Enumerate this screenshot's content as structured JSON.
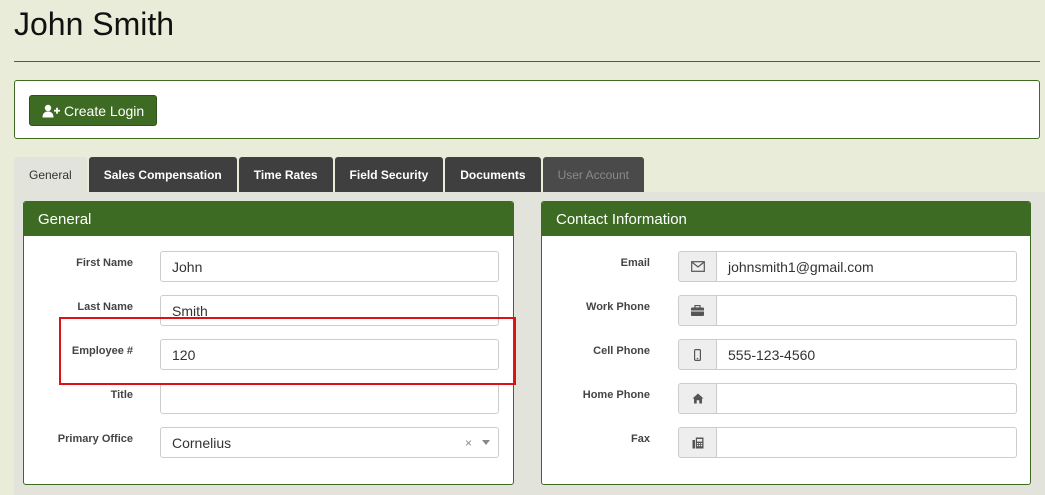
{
  "page": {
    "title": "John Smith"
  },
  "actions": {
    "create_login_label": "Create Login"
  },
  "tabs": [
    {
      "label": "General",
      "state": "active"
    },
    {
      "label": "Sales Compensation",
      "state": "normal"
    },
    {
      "label": "Time Rates",
      "state": "normal"
    },
    {
      "label": "Field Security",
      "state": "normal"
    },
    {
      "label": "Documents",
      "state": "normal"
    },
    {
      "label": "User Account",
      "state": "disabled"
    }
  ],
  "general": {
    "heading": "General",
    "fields": {
      "first_name": {
        "label": "First Name",
        "value": "John"
      },
      "last_name": {
        "label": "Last Name",
        "value": "Smith"
      },
      "employee_no": {
        "label": "Employee #",
        "value": "120"
      },
      "title": {
        "label": "Title",
        "value": ""
      },
      "primary_office": {
        "label": "Primary Office",
        "value": "Cornelius",
        "clear_glyph": "×"
      }
    }
  },
  "contact": {
    "heading": "Contact Information",
    "fields": {
      "email": {
        "label": "Email",
        "value": "johnsmith1@gmail.com",
        "icon": "envelope-icon"
      },
      "work_phone": {
        "label": "Work Phone",
        "value": "",
        "icon": "briefcase-icon"
      },
      "cell_phone": {
        "label": "Cell Phone",
        "value": "555-123-4560",
        "icon": "mobile-phone-icon"
      },
      "home_phone": {
        "label": "Home Phone",
        "value": "",
        "icon": "home-icon"
      },
      "fax": {
        "label": "Fax",
        "value": "",
        "icon": "fax-icon"
      }
    }
  },
  "colors": {
    "accent": "#3e6b24",
    "highlight": "#dd1111",
    "tab_dark": "#3f3f3f",
    "background": "#e9ecd8"
  }
}
